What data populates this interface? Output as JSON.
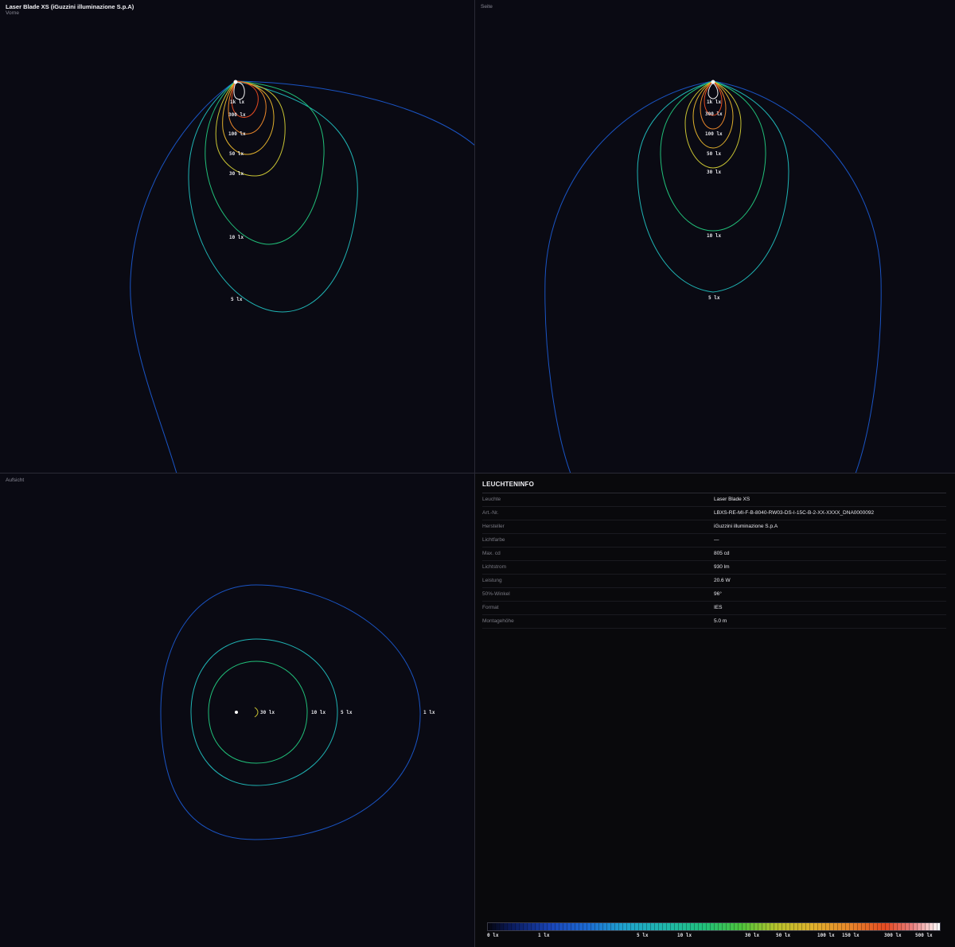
{
  "front": {
    "title": "Laser Blade XS (iGuzzini illuminazione S.p.A)",
    "subtitle": "Vorne"
  },
  "side": {
    "label": "Seite"
  },
  "top": {
    "label": "Aufsicht"
  },
  "iso_labels": {
    "front": [
      "1k lx",
      "300 lx",
      "100 lx",
      "50 lx",
      "30 lx",
      "10 lx",
      "5 lx"
    ],
    "side": [
      "1k lx",
      "300 lx",
      "100 lx",
      "50 lx",
      "30 lx",
      "10 lx",
      "5 lx"
    ],
    "top": [
      "30 lx",
      "10 lx",
      "5 lx",
      "1 lx"
    ]
  },
  "colors": {
    "1": "#1a54c4",
    "5": "#1fb3b3",
    "10": "#21c07a",
    "30": "#c7c233",
    "50": "#e0b02c",
    "100": "#e8862a",
    "300": "#e44a22",
    "1k": "#f0f0f0"
  },
  "info": {
    "title": "LEUCHTENINFO",
    "rows": [
      {
        "key": "Leuchte",
        "value": "Laser Blade XS"
      },
      {
        "key": "Art.-Nr.",
        "value": "LBXS-RE-MI-F-B-8040-RW03-DS-I-15C-B-2-XX-XXXX_DNA0000092"
      },
      {
        "key": "Hersteller",
        "value": "iGuzzini illuminazione S.p.A"
      },
      {
        "key": "Lichtfarbe",
        "value": "—"
      },
      {
        "key": "Max. cd",
        "value": "805 cd"
      },
      {
        "key": "Lichtstrom",
        "value": "930 lm"
      },
      {
        "key": "Leistung",
        "value": "20.6 W"
      },
      {
        "key": "50%-Winkel",
        "value": "96°"
      },
      {
        "key": "Format",
        "value": "IES"
      },
      {
        "key": "Montagehöhe",
        "value": "5.0 m"
      }
    ]
  },
  "legend": {
    "ticks": [
      "0 lx",
      "1 lx",
      "5 lx",
      "10 lx",
      "30 lx",
      "50 lx",
      "100 lx",
      "150 lx",
      "300 lx",
      "500 lx"
    ]
  }
}
